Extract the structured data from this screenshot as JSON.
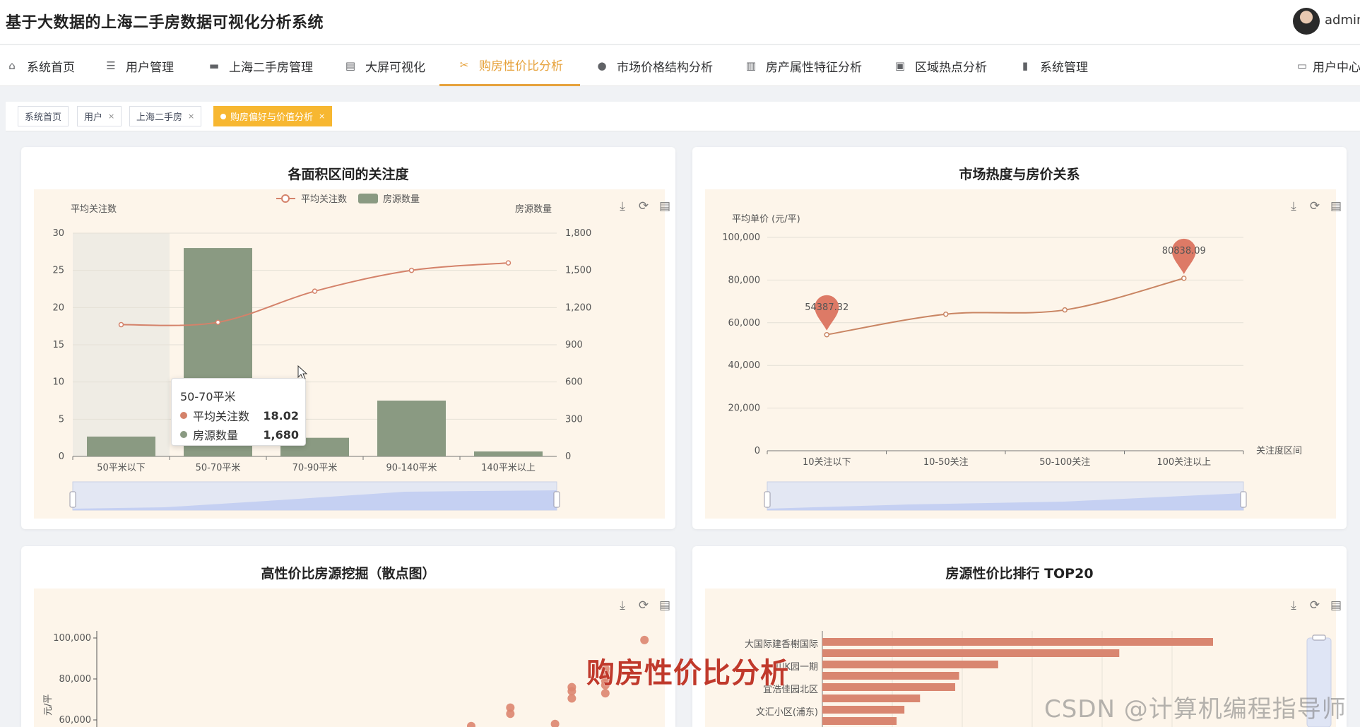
{
  "app": {
    "title": "基于大数据的上海二手房数据可视化分析系统",
    "user": "admin"
  },
  "nav": {
    "items": [
      {
        "label": "系统首页",
        "icon": "home-icon"
      },
      {
        "label": "用户管理",
        "icon": "list-icon"
      },
      {
        "label": "上海二手房管理",
        "icon": "briefcase-icon"
      },
      {
        "label": "大屏可视化",
        "icon": "clipboard-icon"
      },
      {
        "label": "购房性价比分析",
        "icon": "ticket-icon",
        "active": true
      },
      {
        "label": "市场价格结构分析",
        "icon": "lightbulb-icon"
      },
      {
        "label": "房产属性特征分析",
        "icon": "book-icon"
      },
      {
        "label": "区域热点分析",
        "icon": "monitor-icon"
      },
      {
        "label": "系统管理",
        "icon": "bar-chart-icon"
      }
    ],
    "user_center": "用户中心"
  },
  "tags": [
    {
      "label": "系统首页",
      "closable": false
    },
    {
      "label": "用户",
      "closable": true
    },
    {
      "label": "上海二手房",
      "closable": true
    },
    {
      "label": "购房偏好与价值分析",
      "closable": true,
      "active": true
    }
  ],
  "tag_close_glyph": "×",
  "cards": {
    "area_attention": {
      "title": "各面积区间的关注度"
    },
    "heat_price": {
      "title": "市场热度与房价关系"
    },
    "scatter": {
      "title": "高性价比房源挖掘（散点图）"
    },
    "top20": {
      "title": "房源性价比排行 TOP20"
    }
  },
  "tooltip": {
    "title": "50-70平米",
    "rows": [
      {
        "name": "平均关注数",
        "value": "18.02",
        "color": "#d4826a"
      },
      {
        "name": "房源数量",
        "value": "1,680",
        "color": "#8a9a82"
      }
    ]
  },
  "overlay_caption": "购房性价比分析",
  "csdn_watermark": "CSDN @计算机编程指导师",
  "colors": {
    "accent": "#e6a23c",
    "line": "#d4826a",
    "bar": "#8a9a82",
    "plot_bg": "#fdf5ea"
  },
  "chart_data": [
    {
      "type": "bar",
      "title": "各面积区间的关注度",
      "categories": [
        "50平米以下",
        "50-70平米",
        "70-90平米",
        "90-140平米",
        "140平米以上"
      ],
      "series": [
        {
          "name": "平均关注数",
          "type": "line",
          "axis": "left",
          "values": [
            17.7,
            18.02,
            22.2,
            25.0,
            26.0
          ]
        },
        {
          "name": "房源数量",
          "type": "bar",
          "axis": "right",
          "values": [
            160,
            1680,
            150,
            450,
            40
          ]
        }
      ],
      "ylabel_left": "平均关注数",
      "ylim_left": [
        0,
        30
      ],
      "yticks_left": [
        "0",
        "5",
        "10",
        "15",
        "20",
        "25",
        "30"
      ],
      "ylabel_right": "房源数量",
      "ylim_right": [
        0,
        1800
      ],
      "yticks_right": [
        "0",
        "300",
        "600",
        "900",
        "1,200",
        "1,500",
        "1,800"
      ],
      "legend": "top-center",
      "grid": true,
      "highlighted_category": "50平米以下"
    },
    {
      "type": "line",
      "title": "市场热度与房价关系",
      "categories": [
        "10关注以下",
        "10-50关注",
        "50-100关注",
        "100关注以上"
      ],
      "series": [
        {
          "name": "平均单价 (元/平)",
          "values": [
            54387.32,
            64000,
            66000,
            80838.09
          ]
        }
      ],
      "ylabel": "平均单价 (元/平)",
      "xlabel": "关注度区间",
      "ylim": [
        0,
        100000
      ],
      "yticks": [
        "0",
        "20,000",
        "40,000",
        "60,000",
        "80,000",
        "100,000"
      ],
      "markpoints": [
        {
          "label": "54387.32",
          "index": 0
        },
        {
          "label": "80838.09",
          "index": 3
        }
      ],
      "grid": true
    },
    {
      "type": "scatter",
      "title": "高性价比房源挖掘（散点图）",
      "yticks": [
        "100,000",
        "80,000",
        "60,000"
      ],
      "ylabel": "元/平",
      "points": [
        {
          "x": 0.98,
          "y": 99000
        },
        {
          "x": 0.91,
          "y": 85000
        },
        {
          "x": 0.91,
          "y": 83000
        },
        {
          "x": 0.91,
          "y": 81000
        },
        {
          "x": 0.91,
          "y": 79000
        },
        {
          "x": 0.91,
          "y": 77000
        },
        {
          "x": 0.91,
          "y": 73000
        },
        {
          "x": 0.85,
          "y": 76000
        },
        {
          "x": 0.85,
          "y": 74000
        },
        {
          "x": 0.85,
          "y": 70500
        },
        {
          "x": 0.74,
          "y": 66000
        },
        {
          "x": 0.74,
          "y": 63000
        },
        {
          "x": 0.82,
          "y": 58000
        },
        {
          "x": 0.67,
          "y": 57000
        }
      ]
    },
    {
      "type": "bar",
      "orientation": "horizontal",
      "title": "房源性价比排行 TOP20",
      "categories": [
        "大国际建香榭国际",
        "",
        "川K园一期",
        "",
        "宜浩佳园北区",
        "",
        "文汇小区(浦东)"
      ],
      "values": [
        100,
        76,
        45,
        35,
        34,
        25,
        21,
        19
      ]
    }
  ]
}
